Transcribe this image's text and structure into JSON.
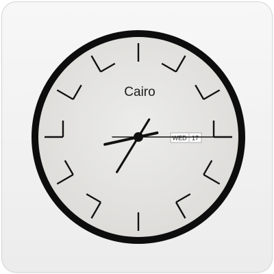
{
  "clock": {
    "city": "Cairo",
    "weekday": "WED",
    "day": "17",
    "time": {
      "hours": 8,
      "minutes": 35,
      "seconds": 15
    }
  },
  "colors": {
    "rim": "#0d0d0d",
    "face": "#e3e2df",
    "ticks": "#111111",
    "hands": "#111111",
    "widget_background": "#efefef"
  }
}
